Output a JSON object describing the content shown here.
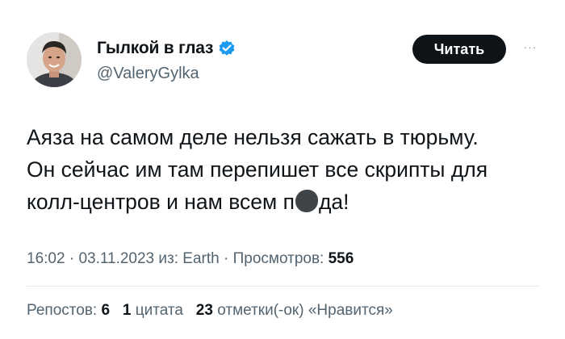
{
  "author": {
    "display_name": "Гылкой в глаз",
    "handle": "@ValeryGylka",
    "verified": true,
    "avatar_icon": "person-photo-icon"
  },
  "follow_button": {
    "label": "Читать"
  },
  "more_icon": "···",
  "tweet": {
    "lines": [
      "Аяза на самом деле нельзя сажать в тюрьму.",
      "Он сейчас им там перепишет все скрипты для",
      "колл-центров и нам всем п",
      "да!"
    ]
  },
  "meta": {
    "time": "16:02",
    "separator": " · ",
    "date": "03.11.2023",
    "source_prefix": " из: ",
    "source": "Earth",
    "views_label": "Просмотров: ",
    "views_count": "556"
  },
  "stats": {
    "reposts_label": "Репостов: ",
    "reposts_count": "6",
    "quotes_count": "1",
    "quotes_label": "цитата",
    "likes_count": "23",
    "likes_label": "отметки(-ок) «Нравится»"
  },
  "colors": {
    "text_primary": "#0f1419",
    "text_secondary": "#536471",
    "verified_blue": "#1d9bf0",
    "button_bg": "#0f1419"
  }
}
